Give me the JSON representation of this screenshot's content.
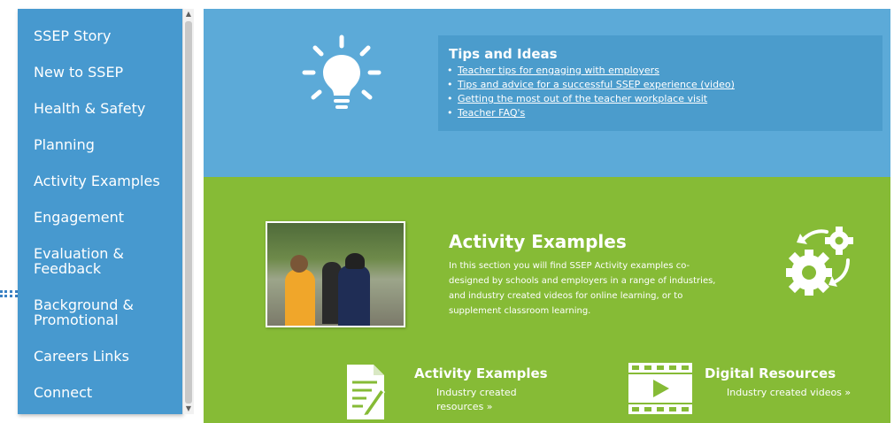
{
  "sidebar": {
    "items": [
      {
        "label": "SSEP Story"
      },
      {
        "label": "New to SSEP"
      },
      {
        "label": "Health & Safety"
      },
      {
        "label": "Planning"
      },
      {
        "label": "Activity Examples"
      },
      {
        "label": "Engagement"
      },
      {
        "label": "Evaluation & Feedback"
      },
      {
        "label": "Background & Promotional"
      },
      {
        "label": "Careers Links"
      },
      {
        "label": "Connect"
      }
    ]
  },
  "tips": {
    "title": "Tips and Ideas",
    "links": [
      {
        "label": "Teacher tips for engaging with employers"
      },
      {
        "label": "Tips and advice for a successful SSEP experience (video)"
      },
      {
        "label": "Getting the most out of the teacher workplace visit"
      },
      {
        "label": "Teacher FAQ's"
      }
    ]
  },
  "activity": {
    "title": "Activity Examples",
    "description": "In this section you will find SSEP Activity examples co-designed by schools and employers in a range of industries, and industry created videos for online learning, or to supplement classroom learning."
  },
  "cards": [
    {
      "title": "Activity Examples",
      "link": "Industry created resources »"
    },
    {
      "title": "Digital Resources",
      "link": "Industry created videos »"
    }
  ],
  "colors": {
    "sidebar": "#4799cf",
    "top_panel": "#5caad8",
    "tips_box": "#4b9ccc",
    "bottom_panel": "#86bb36"
  },
  "icons": [
    "lightbulb-icon",
    "gears-icon",
    "document-pencil-icon",
    "video-play-icon"
  ]
}
